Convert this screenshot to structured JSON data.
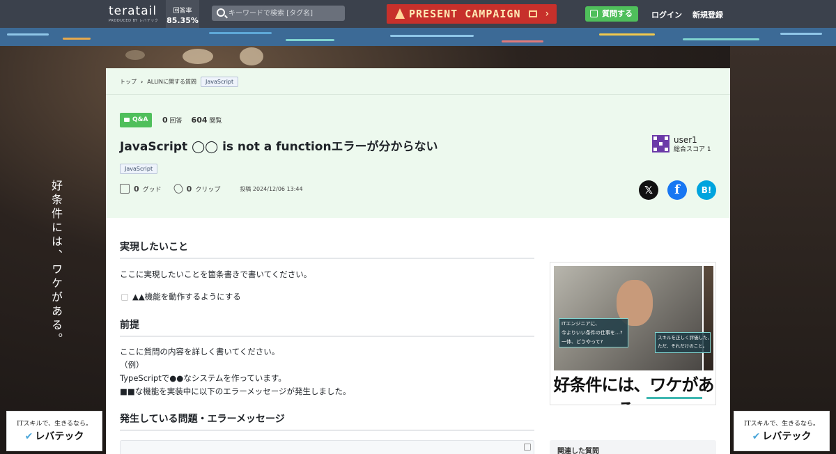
{
  "header": {
    "logo": "teratail",
    "logo_sub": "PRODUCED BY レバテック",
    "answer_rate_label": "回答率",
    "answer_rate_value": "85.35%",
    "search_placeholder": "キーワードで検索 [タグ名]",
    "campaign_label": "PRESENT CAMPAIGN",
    "ask_label": "質問する",
    "login_label": "ログイン",
    "signup_label": "新規登録"
  },
  "side_ad": {
    "vertical_text": "好条件には、ワケがある。",
    "badge_line1": "ITスキルで、生きるなら。",
    "badge_line2": "レバテック"
  },
  "breadcrumb": {
    "items": [
      "トップ",
      "ALLINに関する質問"
    ],
    "tag": "JavaScript"
  },
  "question": {
    "type_badge": "Q&A",
    "answers_count": "0",
    "answers_label": "回答",
    "views_count": "604",
    "views_label": "閲覧",
    "title": "JavaScript ◯◯ is not a functionエラーが分からない",
    "tag": "JavaScript",
    "good_count": "0",
    "good_label": "グッド",
    "clip_count": "0",
    "clip_label": "クリップ",
    "posted_label": "投稿",
    "posted_at": "2024/12/06 13:44",
    "user_name": "user1",
    "user_score_label": "総合スコア",
    "user_score": "1"
  },
  "share": {
    "x_icon": "x-logo-icon",
    "facebook_icon": "facebook-icon",
    "hatena_icon": "hatena-bookmark-icon",
    "hatena_text": "B!"
  },
  "body": {
    "section1_title": "実現したいこと",
    "section1_text": "ここに実現したいことを箇条書きで書いてください。",
    "checklist_item": "▲▲機能を動作するようにする",
    "section2_title": "前提",
    "section2_text": "ここに質問の内容を詳しく書いてください。\n（例）\nTypeScriptで●●なシステムを作っています。\n■■な機能を実装中に以下のエラーメッセージが発生しました。",
    "section3_title": "発生している問題・エラーメッセージ"
  },
  "ad": {
    "box1_text": "ITエンジニアに、\n今よりいい条件の仕事を…?\n一体、どうやって?",
    "box2_text": "スキルを正しく評価した、\nただ、それだけのこと。",
    "headline": "好条件には、ワケがある。"
  },
  "sidebar": {
    "related_title": "関連した質問"
  }
}
